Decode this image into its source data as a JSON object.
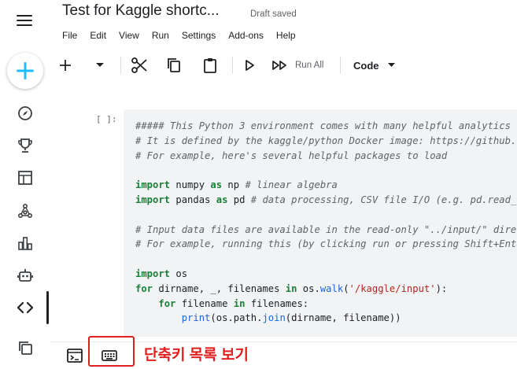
{
  "header": {
    "title": "Test for Kaggle shortc...",
    "status": "Draft saved",
    "menu": [
      "File",
      "Edit",
      "View",
      "Run",
      "Settings",
      "Add-ons",
      "Help"
    ]
  },
  "toolbar": {
    "run_all_label": "Run All",
    "cell_type": "Code"
  },
  "cell": {
    "prompt": "[ ]:"
  },
  "annotation": {
    "text": "단축키 목록 보기",
    "color": "#e02020"
  },
  "colors": {
    "accent": "#20beff",
    "code_bg": "#f1f3f4"
  },
  "icons": {
    "rail": [
      "menu-icon",
      "create-icon",
      "compass-icon",
      "trophy-icon",
      "table-icon",
      "models-icon",
      "bar-chart-icon",
      "robot-icon",
      "code-icon",
      "copy-icon"
    ],
    "toolbar": [
      "add-icon",
      "chevron-down-icon",
      "cut-icon",
      "copy-icon",
      "paste-icon",
      "play-icon",
      "run-all-icon"
    ],
    "bottom": [
      "console-icon",
      "keyboard-icon"
    ]
  }
}
